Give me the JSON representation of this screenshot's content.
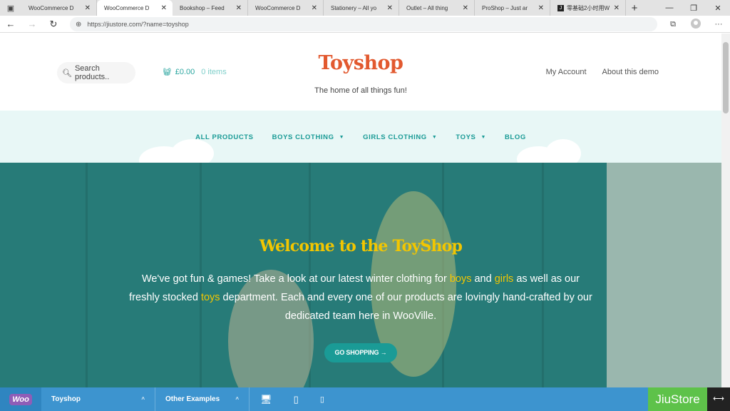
{
  "browser": {
    "tabs": [
      {
        "label": "WooCommerce D",
        "active": false
      },
      {
        "label": "WooCommerce D",
        "active": true
      },
      {
        "label": "Bookshop – Feed",
        "active": false
      },
      {
        "label": "WooCommerce D",
        "active": false
      },
      {
        "label": "Stationery – All yo",
        "active": false
      },
      {
        "label": "Outlet – All thing",
        "active": false
      },
      {
        "label": "ProShop – Just ar",
        "active": false
      },
      {
        "label": "零基础2小时用W",
        "active": false,
        "favicon": "J"
      }
    ],
    "url": "https://jiustore.com/?name=toyshop"
  },
  "site": {
    "search_placeholder": "Search products..",
    "cart_total": "£0.00",
    "cart_items": "0 items",
    "logo": "Toyshop",
    "tagline": "The home of all things fun!",
    "header_links": [
      "My Account",
      "About this demo"
    ]
  },
  "nav": {
    "items": [
      {
        "label": "ALL PRODUCTS",
        "dropdown": false
      },
      {
        "label": "BOYS CLOTHING",
        "dropdown": true
      },
      {
        "label": "GIRLS CLOTHING",
        "dropdown": true
      },
      {
        "label": "TOYS",
        "dropdown": true
      },
      {
        "label": "BLOG",
        "dropdown": false
      }
    ]
  },
  "hero": {
    "title": "Welcome to the ToyShop",
    "text_1": "We've got fun & games! Take a look at our latest winter clothing for ",
    "link_boys": "boys",
    "text_2": " and ",
    "link_girls": "girls",
    "text_3": " as well as our freshly stocked ",
    "link_toys": "toys",
    "text_4": " department. Each and every one of our products are lovingly hand-crafted by our dedicated team here in WooVille.",
    "button": "GO SHOPPING →"
  },
  "demo_bar": {
    "woo_logo": "Woo",
    "current_demo": "Toyshop",
    "other_examples": "Other Examples",
    "brand": "JiuStore"
  },
  "colors": {
    "accent_teal": "#1a9b96",
    "logo_orange": "#e2592f",
    "hero_yellow": "#f3c600",
    "demo_bar_blue": "#3d94cf",
    "brand_green": "#5ec24a"
  }
}
